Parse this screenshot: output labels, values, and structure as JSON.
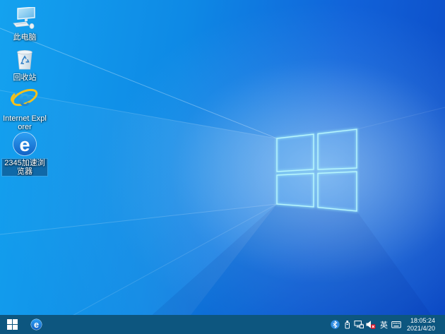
{
  "wallpaper": {
    "style": "windows10-light-hero",
    "base_color_bottom_left": "#14a2ef",
    "base_color_top_right": "#0c49c4",
    "logo_edge_color": "#a5f2fb"
  },
  "desktop_icons": [
    {
      "name": "this-pc",
      "label": "此电脑",
      "selected": false
    },
    {
      "name": "recycle-bin",
      "label": "回收站",
      "selected": false
    },
    {
      "name": "internet-explorer",
      "label": "Internet Explorer",
      "selected": false
    },
    {
      "name": "browser-2345",
      "label": "2345加速浏览器",
      "selected": true
    }
  ],
  "taskbar": {
    "background_color": "#0d567f",
    "start_button": {
      "icon": "windows-logo-icon"
    },
    "pinned_apps": [
      {
        "name": "browser-2345",
        "icon": "e-browser-icon"
      }
    ],
    "tray": {
      "icons": [
        {
          "name": "bluetooth-icon"
        },
        {
          "name": "usb-device-icon"
        },
        {
          "name": "network-icon"
        },
        {
          "name": "volume-muted-icon"
        },
        {
          "name": "language-indicator",
          "text": "英"
        },
        {
          "name": "touch-keyboard-icon"
        }
      ],
      "clock": {
        "time": "18:05:24",
        "date": "2021/4/20"
      }
    },
    "show_desktop_button": true
  }
}
